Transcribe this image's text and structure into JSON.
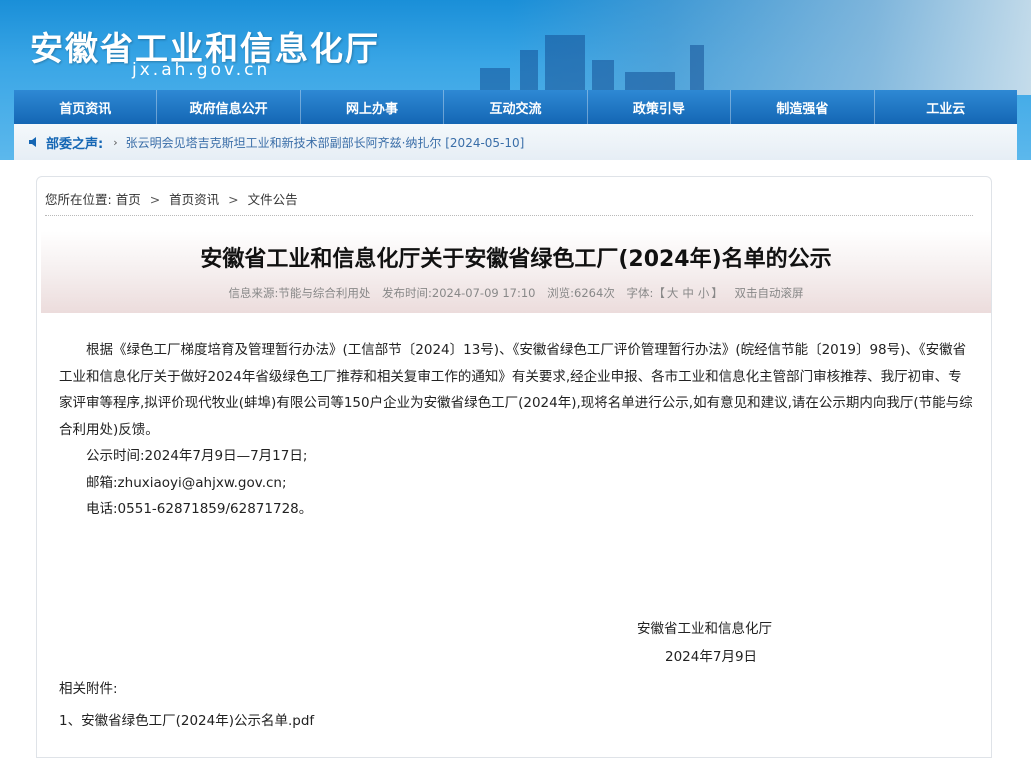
{
  "header": {
    "site_title": "安徽省工业和信息化厅",
    "site_domain": "jx.ah.gov.cn"
  },
  "nav": [
    {
      "label": "首页资讯"
    },
    {
      "label": "政府信息公开"
    },
    {
      "label": "网上办事"
    },
    {
      "label": "互动交流"
    },
    {
      "label": "政策引导"
    },
    {
      "label": "制造强省"
    },
    {
      "label": "工业云"
    }
  ],
  "ticker": {
    "label": "部委之声:",
    "separator": "›",
    "text": "张云明会见塔吉克斯坦工业和新技术部副部长阿齐兹·纳扎尔 [2024-05-10]"
  },
  "breadcrumb": {
    "prefix": "您所在位置:",
    "items": [
      "首页",
      "首页资讯",
      "文件公告"
    ],
    "separator": ">"
  },
  "article": {
    "title": "安徽省工业和信息化厅关于安徽省绿色工厂(2024年)名单的公示",
    "meta": {
      "source": "信息来源:节能与综合利用处",
      "date": "发布时间:2024-07-09 17:10",
      "views": "浏览:6264次",
      "font_label": "字体:",
      "bracket_open": "【",
      "font_large": "大",
      "font_medium": "中",
      "font_small": "小",
      "bracket_close": "】",
      "autoscroll": "双击自动滚屏"
    },
    "paragraphs": [
      "根据《绿色工厂梯度培育及管理暂行办法》(工信部节〔2024〕13号)、《安徽省绿色工厂评价管理暂行办法》(皖经信节能〔2019〕98号)、《安徽省工业和信息化厅关于做好2024年省级绿色工厂推荐和相关复审工作的通知》有关要求,经企业申报、各市工业和信息化主管部门审核推荐、我厅初审、专家评审等程序,拟评价现代牧业(蚌埠)有限公司等150户企业为安徽省绿色工厂(2024年),现将名单进行公示,如有意见和建议,请在公示期内向我厅(节能与综合利用处)反馈。",
      "公示时间:2024年7月9日—7月17日;",
      "邮箱:zhuxiaoyi@ahjxw.gov.cn;",
      "电话:0551-62871859/62871728。"
    ],
    "signature_org": "安徽省工业和信息化厅",
    "signature_date": "2024年7月9日",
    "attachments_label": "相关附件:",
    "attachments": [
      "1、安徽省绿色工厂(2024年)公示名单.pdf"
    ]
  }
}
